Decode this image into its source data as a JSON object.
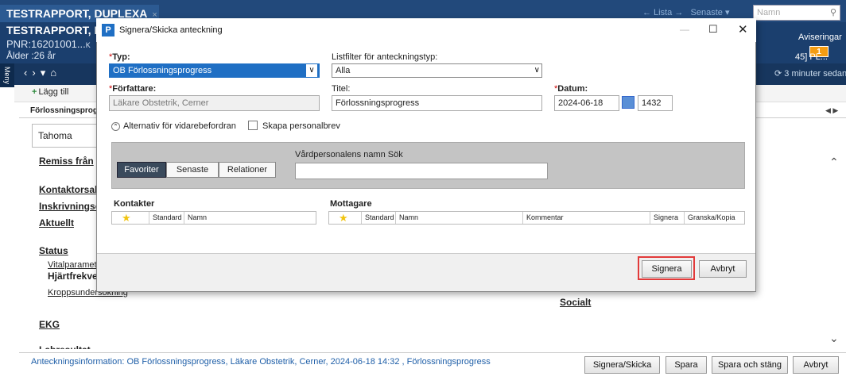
{
  "app": {
    "tab_title": "TESTRAPPORT, DUPLEXA",
    "tab_close": "×",
    "patient_name": "TESTRAPPORT, D",
    "pnr": "PNR:16201001...",
    "pnr_suffix": "K",
    "age": "Ålder :26 år",
    "nav_lista": "← Lista  →",
    "nav_senaste": "Senaste ▾",
    "search_placeholder": "Namn",
    "avisering_label": "Aviseringar",
    "avisering_count": "1",
    "pl_text": "45] PL...",
    "refresh_text": "3 minuter sedan",
    "meny": "Meny"
  },
  "toolbar": {
    "lagg_till": "Lägg till"
  },
  "document": {
    "sublabel": "Förlossningsprogr",
    "font_name": "Tahoma",
    "sections": {
      "remiss": "Remiss från",
      "kontaktorsak": "Kontaktorsak",
      "inskrivning": "Inskrivningsor",
      "aktuellt": "Aktuellt",
      "status": "Status",
      "vitalparam": "Vitalparametra",
      "hjartfrekvens": "Hjärtfrekver",
      "kropp": "Kroppsundersökning",
      "socialt": "Socialt",
      "ekg": "EKG",
      "lab": "Labresultat"
    }
  },
  "footer": {
    "info": "Anteckningsinformation: OB Förlossningsprogress, Läkare Obstetrik, Cerner, 2024-06-18 14:32 , Förlossningsprogress",
    "btn_signera": "Signera/Skicka",
    "btn_spara": "Spara",
    "btn_spara_stang": "Spara och stäng",
    "btn_avbryt": "Avbryt"
  },
  "dialog": {
    "title": "Signera/Skicka anteckning",
    "typ_label": "Typ:",
    "typ_value": "OB Förlossningsprogress",
    "listfilter_label": "Listfilter för anteckningstyp:",
    "listfilter_value": "Alla",
    "forfattare_label": "Författare:",
    "forfattare_value": "Läkare Obstetrik, Cerner",
    "titel_label": "Titel:",
    "titel_value": "Förlossningsprogress",
    "datum_label": "Datum:",
    "datum_value": "2024-06-18",
    "tid_value": "1432",
    "alternativ_label": "Alternativ för vidarebefordran",
    "skapa_label": "Skapa personalbrev",
    "tab_favoriter": "Favoriter",
    "tab_senaste": "Senaste",
    "tab_relationer": "Relationer",
    "vard_label": "Vårdpersonalens namn Sök",
    "kontakter_label": "Kontakter",
    "mottagare_label": "Mottagare",
    "col_standard": "Standard",
    "col_namn": "Namn",
    "col_kommentar": "Kommentar",
    "col_signera": "Signera",
    "col_granska": "Granska/Kopia",
    "btn_signera": "Signera",
    "btn_avbryt": "Avbryt"
  }
}
